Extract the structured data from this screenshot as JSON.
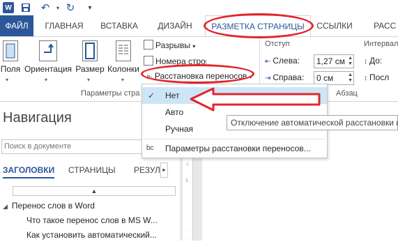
{
  "quick_access": {
    "logo": "W",
    "save_icon": "floppy",
    "undo_icon": "undo",
    "redo_icon": "repeat"
  },
  "tabs": {
    "file": "ФАЙЛ",
    "items": [
      "ГЛАВНАЯ",
      "ВСТАВКА",
      "ДИЗАЙН",
      "РАЗМЕТКА СТРАНИЦЫ",
      "ССЫЛКИ",
      "РАСС"
    ]
  },
  "ribbon": {
    "fields": "Поля",
    "orientation": "Ориентация",
    "size": "Размер",
    "columns": "Колонки",
    "breaks": "Разрывы",
    "line_numbers": "Номера строк",
    "hyphenation": "Расстановка переносов",
    "group_page_setup": "Параметры стра",
    "indent_label": "Отступ",
    "left_label": "Слева:",
    "left_value": "1,27 см",
    "right_label": "Справа:",
    "right_value": "0 см",
    "interval_label": "Интервал",
    "before_label": "До:",
    "after_label": "Посл",
    "group_paragraph": "Абзац"
  },
  "dropdown": {
    "items": [
      {
        "label": "Нет",
        "checked": true
      },
      {
        "label": "Авто",
        "checked": false
      },
      {
        "label": "Ручная",
        "checked": false
      },
      {
        "label": "Параметры расстановки переносов...",
        "checked": false
      }
    ],
    "options_icon": "bc"
  },
  "tooltip": "Отключение автоматической расстановки пе",
  "navigation": {
    "title": "Навигация",
    "search_placeholder": "Поиск в документе",
    "tabs": [
      "ЗАГОЛОВКИ",
      "СТРАНИЦЫ",
      "РЕЗУЛ"
    ],
    "tree": [
      {
        "label": "Перенос слов в Word",
        "level": 0
      },
      {
        "label": "Что такое перенос слов в MS W...",
        "level": 1
      },
      {
        "label": "Как установить автоматический...",
        "level": 1
      }
    ]
  },
  "colors": {
    "accent": "#2b579a",
    "annotation": "#e3242b",
    "highlight": "#cde6f7"
  }
}
